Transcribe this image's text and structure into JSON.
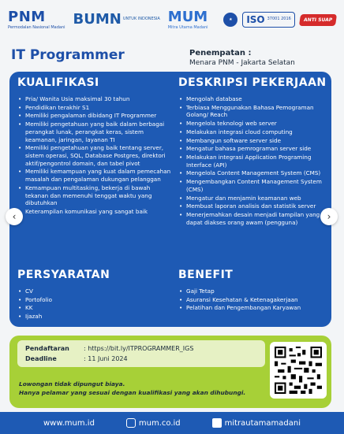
{
  "header": {
    "pnm_logo": "PNM",
    "pnm_subtitle": "Permodalan Nasional Madani",
    "bumn_logo": "BUMN",
    "bumn_subtitle": "UNTUK INDONESIA",
    "mum_logo": "MUM",
    "mum_subtitle": "Mitra Utama Madani",
    "iso_label": "ISO",
    "iso_sub": "37001 2016",
    "anti_suap": "ANTI SUAP"
  },
  "job": {
    "title": "IT Programmer",
    "placement_label": "Penempatan :",
    "placement_value": "Menara PNM - Jakarta Selatan"
  },
  "kualifikasi": {
    "heading": "KUALIFIKASI",
    "items": [
      "Pria/ Wanita Usia maksimal 30 tahun",
      "Pendidikan terakhir S1",
      "Memiliki pengalaman dibidang IT Programmer",
      "Memiliki pengetahuan yang baik dalam berbagai perangkat lunak, perangkat keras, sistem keamanan, jaringan, layanan TI",
      "Memiliki pengetahuan yang baik tentang server, sistem operasi, SQL, Database Postgres, direktori aktif/pengontrol domain, dan tabel pivot",
      "Memiliki kemampuan yang kuat dalam pemecahan masalah dan pengalaman dukungan pelanggan",
      "Kemampuan multitasking, bekerja di bawah tekanan dan memenuhi tenggat waktu yang dibutuhkan",
      "Keterampilan komunikasi yang sangat baik"
    ]
  },
  "deskripsi": {
    "heading": "DESKRIPSI PEKERJAAN",
    "items": [
      "Mengolah database",
      "Terbiasa Menggunakan Bahasa Pemograman Golang/ Reach",
      "Mengelola teknologi web server",
      "Melakukan integrasi cloud computing",
      "Membangun software server side",
      "Mengatur bahasa pemrograman server side",
      "Melakukan integrasi Application Programing Interface (API)",
      "Mengelola Content Management System (CMS)",
      "Mengembangkan Content Management System (CMS)",
      "Mengatur dan menjamin keamanan web",
      "Membuat laporan analisis dan statistik server",
      "Menerjemahkan desain menjadi tampilan yang dapat diakses orang awam (pengguna)"
    ]
  },
  "persyaratan": {
    "heading": "PERSYARATAN",
    "items": [
      "CV",
      "Portofolio",
      "KK",
      "Ijazah"
    ]
  },
  "benefit": {
    "heading": "BENEFIT",
    "items": [
      "Gaji Tetap",
      "Asuransi Kesehatan & Ketenagakerjaan",
      "Pelatihan dan Pengembangan Karyawan"
    ]
  },
  "apply": {
    "pendaftaran_label": "Pendaftaran",
    "pendaftaran_value": ": https://bit.ly/ITPROGRAMMER_IGS",
    "deadline_label": "Deadline",
    "deadline_value": ": 11 Juni 2024",
    "note1": "Lowongan tidak dipungut biaya.",
    "note2": "Hanya pelamar yang sesuai dengan kualifikasi yang akan dihubungi."
  },
  "footer": {
    "website": "www.mum.id",
    "instagram": "mum.co.id",
    "youtube": "mitrautamamadani"
  },
  "carousel": {
    "prev_icon": "‹",
    "next_icon": "›",
    "active_index": 1,
    "count": 5
  },
  "colors": {
    "primary": "#1e5ab4",
    "green": "#a7d037",
    "red": "#d52b2b"
  }
}
